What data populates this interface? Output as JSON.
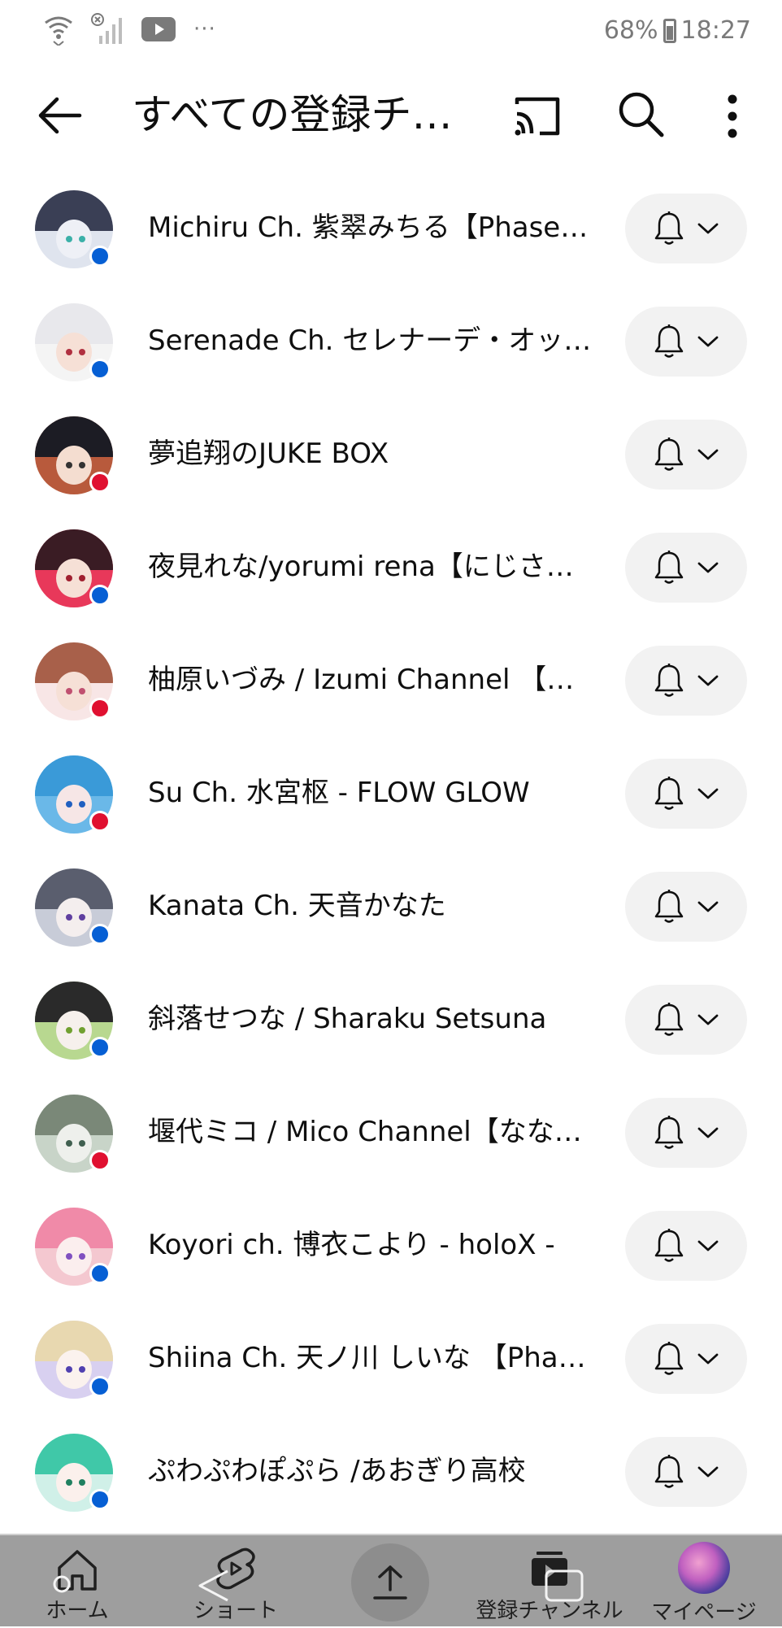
{
  "status_bar": {
    "battery": "68%",
    "time": "18:27",
    "overflow": "···"
  },
  "header": {
    "title": "すべての登録チ…"
  },
  "colors": {
    "live_blue": "#065fd4",
    "new_red": "#e01030",
    "pill_bg": "#f2f2f2",
    "nav_bg": "#9e9e9e"
  },
  "channels": [
    {
      "name": "Michiru Ch. 紫翠みちる【Phase …",
      "dot": "blue"
    },
    {
      "name": "Serenade Ch. セレナーデ・オッ…",
      "dot": "blue"
    },
    {
      "name": "夢追翔のJUKE BOX",
      "dot": "red"
    },
    {
      "name": "夜見れな/yorumi rena【にじさ…",
      "dot": "blue"
    },
    {
      "name": "柚原いづみ / Izumi Channel 【…",
      "dot": "red"
    },
    {
      "name": "Su Ch. 水宮枢 - FLOW GLOW",
      "dot": "red"
    },
    {
      "name": "Kanata Ch. 天音かなた",
      "dot": "blue"
    },
    {
      "name": "斜落せつな / Sharaku Setsuna",
      "dot": "blue"
    },
    {
      "name": "堰代ミコ / Mico Channel【なな…",
      "dot": "red"
    },
    {
      "name": "Koyori ch. 博衣こより - holoX -",
      "dot": "blue"
    },
    {
      "name": "Shiina Ch. 天ノ川 しいな 【Pha…",
      "dot": "blue"
    },
    {
      "name": "ぷわぷわぽぷら /あおぎり高校",
      "dot": "blue"
    }
  ],
  "bottom_nav": {
    "home": "ホーム",
    "shorts": "ショート",
    "subscriptions": "登録チャンネル",
    "you": "マイページ"
  }
}
